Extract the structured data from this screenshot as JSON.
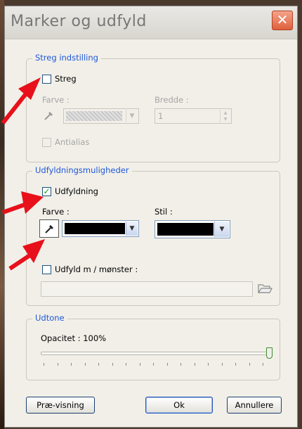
{
  "dialog": {
    "title": "Marker og udfyld"
  },
  "stroke_group": {
    "legend": "Streg indstilling",
    "stroke_checkbox_label": "Streg",
    "stroke_checked": false,
    "color_label": "Farve :",
    "width_label": "Bredde :",
    "width_value": "1",
    "antialias_label": "Antialias",
    "antialias_checked": false
  },
  "fill_group": {
    "legend": "Udfyldningsmuligheder",
    "fill_checkbox_label": "Udfyldning",
    "fill_checked": true,
    "color_label": "Farve :",
    "style_label": "Stil :",
    "fill_color": "#000000",
    "style_color": "#000000",
    "pattern_checkbox_label": "Udfyld m / mønster :",
    "pattern_checked": false,
    "pattern_path": ""
  },
  "tone_group": {
    "legend": "Udtone",
    "opacity_label": "Opacitet : 100%",
    "opacity": 1.0
  },
  "buttons": {
    "preview": "Præ-visning",
    "ok": "Ok",
    "cancel": "Annullere"
  },
  "colors": {
    "legend_blue": "#1f58d8",
    "annotation_red": "#e8101a",
    "check_green": "#1aa01a"
  }
}
